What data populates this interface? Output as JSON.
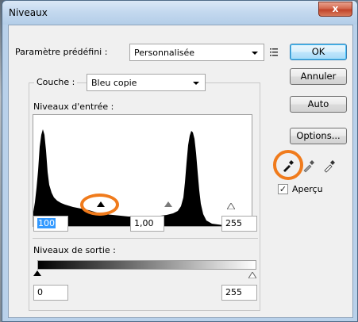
{
  "window": {
    "title": "Niveaux",
    "close_glyph": "x"
  },
  "preset": {
    "label": "Paramètre prédéfini :",
    "value": "Personnalisée",
    "menu_icon": "list-menu-icon"
  },
  "channel": {
    "label": "Couche :",
    "value": "Bleu copie"
  },
  "input_levels": {
    "label": "Niveaux d'entrée :",
    "black_value": "100",
    "gamma_value": "1,00",
    "white_value": "255"
  },
  "output_levels": {
    "label": "Niveaux de sortie :",
    "black_value": "0",
    "white_value": "255"
  },
  "buttons": {
    "ok": "OK",
    "cancel": "Annuler",
    "auto": "Auto",
    "options": "Options..."
  },
  "eyedroppers": [
    "black-eyedropper-icon",
    "gray-eyedropper-icon",
    "white-eyedropper-icon"
  ],
  "preview": {
    "label": "Aperçu",
    "checked": true
  },
  "colors": {
    "highlight": "#f07b1c",
    "selection": "#3399ff"
  }
}
